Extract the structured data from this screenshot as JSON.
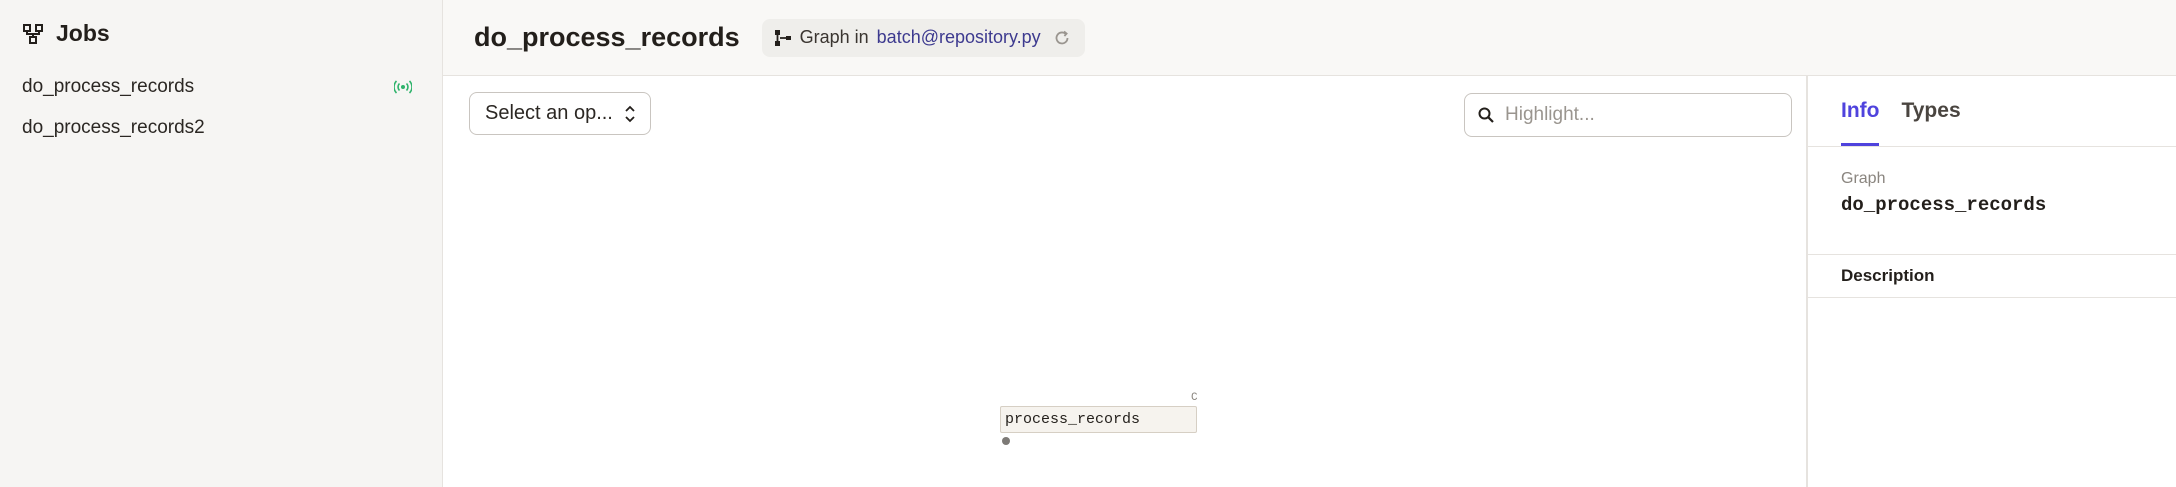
{
  "sidebar": {
    "title": "Jobs",
    "title_icon": "jobs-icon",
    "items": [
      {
        "label": "do_process_records",
        "status_icon": "sensor-icon",
        "status_color": "#2fb36b"
      },
      {
        "label": "do_process_records2"
      }
    ]
  },
  "header": {
    "title": "do_process_records",
    "graph_icon": "graph-icon",
    "graph_in": "Graph in",
    "repo": "batch@repository.py",
    "reload_icon": "reload-icon"
  },
  "graph": {
    "select_label": "Select an op...",
    "highlight_placeholder": "Highlight...",
    "node_label": "process_records",
    "node_corner": "C"
  },
  "panel": {
    "tabs": [
      {
        "label": "Info",
        "active": true
      },
      {
        "label": "Types",
        "active": false
      }
    ],
    "section_label": "Graph",
    "graph_name": "do_process_records",
    "description_label": "Description"
  },
  "colors": {
    "accent": "#4f43dd",
    "link": "#3d3a8f",
    "sensor": "#2fb36b"
  }
}
